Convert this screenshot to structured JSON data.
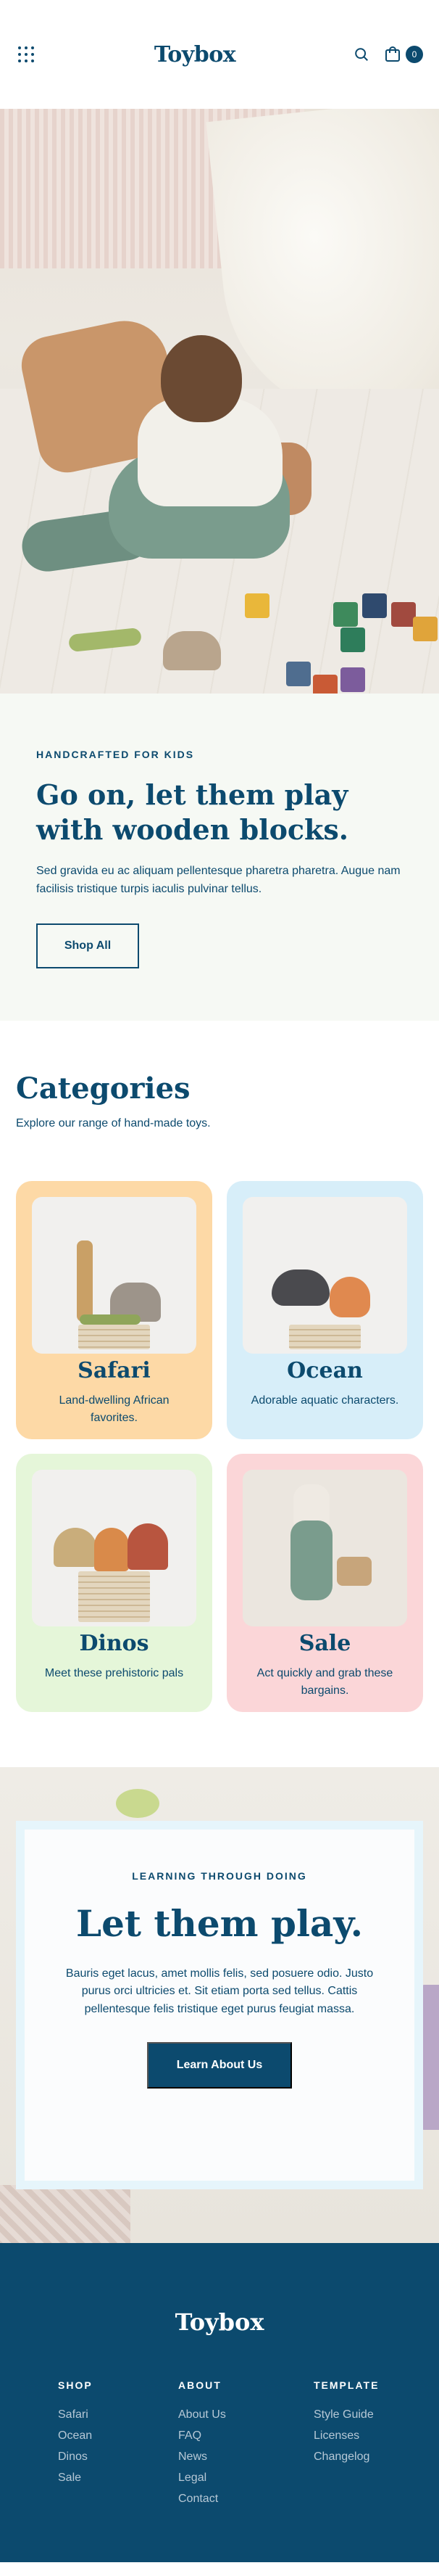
{
  "header": {
    "logo": "Toybox",
    "cart_count": "0"
  },
  "craft": {
    "eyebrow": "HANDCRAFTED FOR KIDS",
    "title": "Go on, let them play with wooden blocks.",
    "body": "Sed gravida eu ac aliquam pellentesque pharetra pharetra. Augue nam facilisis tristique turpis iaculis pulvinar tellus.",
    "button": "Shop All"
  },
  "categories": {
    "title": "Categories",
    "subtitle": "Explore our range of hand-made toys.",
    "items": [
      {
        "name": "Safari",
        "desc": "Land-dwelling African favorites.",
        "bg": "#fdd9a6"
      },
      {
        "name": "Ocean",
        "desc": "Adorable aquatic characters.",
        "bg": "#d7eef9"
      },
      {
        "name": "Dinos",
        "desc": "Meet these prehistoric pals",
        "bg": "#e5f6d9"
      },
      {
        "name": "Sale",
        "desc": "Act quickly and grab these bargains.",
        "bg": "#fbd6d8"
      }
    ]
  },
  "play": {
    "eyebrow": "LEARNING THROUGH DOING",
    "title": "Let them play.",
    "body": "Bauris eget lacus, amet mollis felis, sed posuere odio. Justo purus orci ultricies et. Sit etiam porta sed tellus. Cattis pellentesque felis tristique eget purus feugiat massa.",
    "button": "Learn About Us"
  },
  "footer": {
    "logo": "Toybox",
    "columns": [
      {
        "heading": "SHOP",
        "links": [
          "Safari",
          "Ocean",
          "Dinos",
          "Sale"
        ]
      },
      {
        "heading": "ABOUT",
        "links": [
          "About Us",
          "FAQ",
          "News",
          "Legal",
          "Contact"
        ]
      },
      {
        "heading": "TEMPLATE",
        "links": [
          "Style Guide",
          "Licenses",
          "Changelog"
        ]
      }
    ]
  },
  "colors": {
    "brand_navy": "#0c4a6e",
    "craft_bg": "#f6f9f4",
    "play_card_border": "#e6f5fb"
  }
}
